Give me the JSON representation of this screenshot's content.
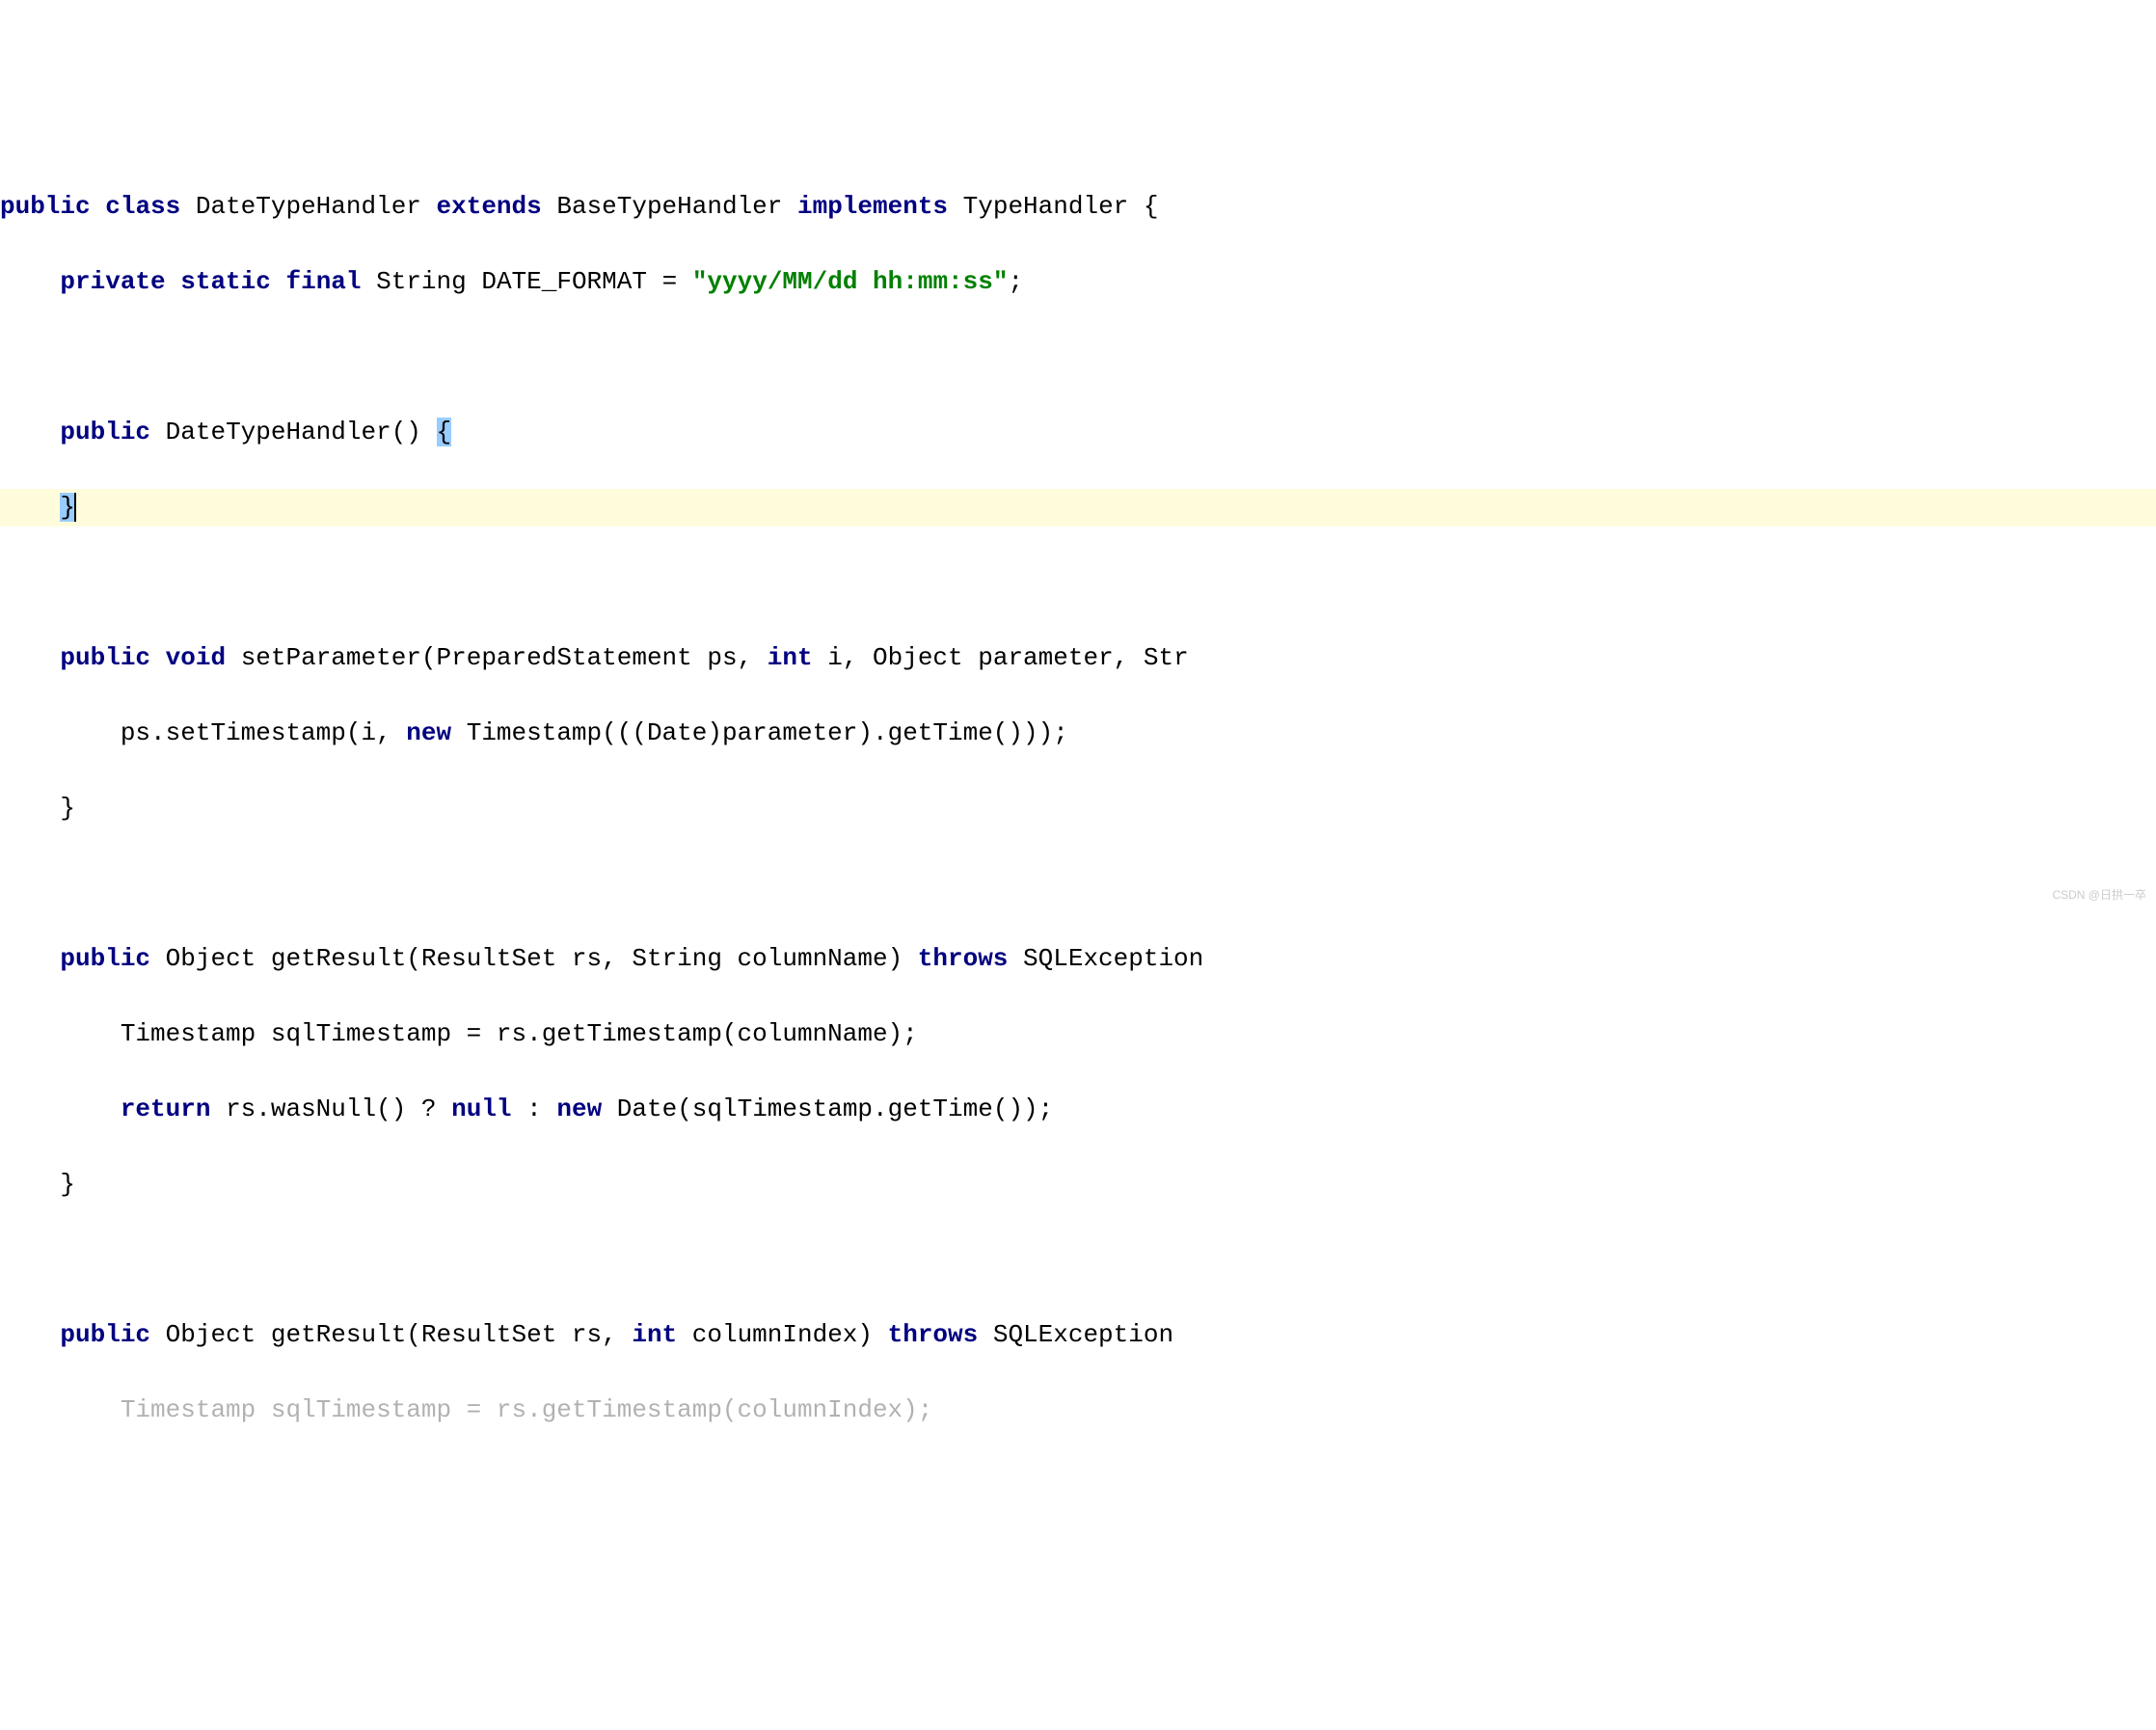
{
  "code": {
    "line1": {
      "kw_public": "public",
      "kw_class": "class",
      "class_name": "DateTypeHandler",
      "kw_extends": "extends",
      "base_class": "BaseTypeHandler",
      "kw_implements": "implements",
      "interface": "TypeHandler",
      "brace": "{"
    },
    "line2": {
      "kw_private": "private",
      "kw_static": "static",
      "kw_final": "final",
      "type": "String",
      "var_name": "DATE_FORMAT",
      "eq": "=",
      "value": "\"yyyy/MM/dd hh:mm:ss\"",
      "semi": ";"
    },
    "line4": {
      "kw_public": "public",
      "constructor": "DateTypeHandler()",
      "brace": "{"
    },
    "line5": {
      "brace": "}"
    },
    "line7": {
      "kw_public": "public",
      "kw_void": "void",
      "method": "setParameter(PreparedStatement ps,",
      "kw_int": "int",
      "param2": "i, Object parameter, Str"
    },
    "line8": {
      "body": "ps.setTimestamp(i,",
      "kw_new": "new",
      "rest": "Timestamp(((Date)parameter).getTime()));"
    },
    "line9": {
      "brace": "}"
    },
    "line11": {
      "kw_public": "public",
      "ret": "Object getResult(ResultSet rs, String columnName)",
      "kw_throws": "throws",
      "exc": "SQLException"
    },
    "line12": {
      "body": "Timestamp sqlTimestamp = rs.getTimestamp(columnName);"
    },
    "line13": {
      "kw_return": "return",
      "expr1": "rs.wasNull() ?",
      "kw_null": "null",
      "colon": ":",
      "kw_new": "new",
      "expr2": "Date(sqlTimestamp.getTime());"
    },
    "line14": {
      "brace": "}"
    },
    "line16": {
      "kw_public": "public",
      "ret": "Object getResult(ResultSet rs,",
      "kw_int": "int",
      "param": "columnIndex)",
      "kw_throws": "throws",
      "exc": "SQLException"
    },
    "line17": {
      "body": "Timestamp sqlTimestamp = rs.getTimestamp(columnIndex);"
    }
  },
  "watermark": "CSDN @日拱一卒"
}
